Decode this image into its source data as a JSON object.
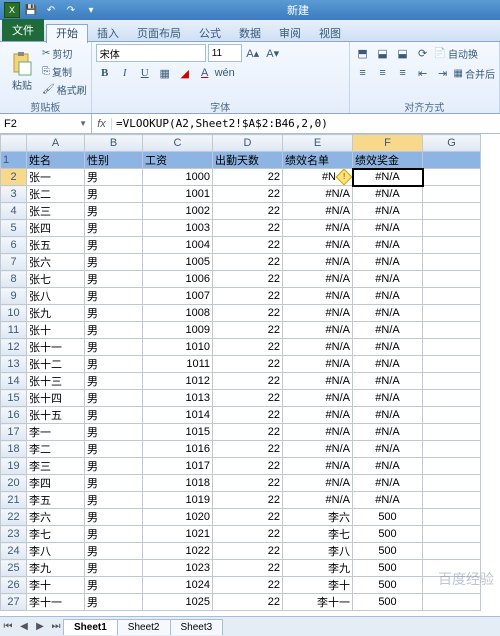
{
  "window": {
    "title": "新建"
  },
  "tabs": {
    "file": "文件",
    "items": [
      "开始",
      "插入",
      "页面布局",
      "公式",
      "数据",
      "审阅",
      "视图"
    ],
    "active": 0
  },
  "ribbon": {
    "clipboard": {
      "paste": "粘贴",
      "cut": "剪切",
      "copy": "复制",
      "format_painter": "格式刷",
      "label": "剪贴板"
    },
    "font": {
      "name": "宋体",
      "size": "11",
      "label": "字体"
    },
    "alignment": {
      "wrap": "自动换",
      "merge": "合并后",
      "label": "对齐方式"
    }
  },
  "formula_bar": {
    "cell_ref": "F2",
    "formula": "=VLOOKUP(A2,Sheet2!$A$2:B46,2,0)"
  },
  "columns": [
    "A",
    "B",
    "C",
    "D",
    "E",
    "F",
    "G"
  ],
  "headers": {
    "A": "姓名",
    "B": "性别",
    "C": "工资",
    "D": "出勤天数",
    "E": "绩效名单",
    "F": "绩效奖金"
  },
  "chart_data": {
    "type": "table",
    "columns": [
      "姓名",
      "性别",
      "工资",
      "出勤天数",
      "绩效名单",
      "绩效奖金"
    ],
    "rows": [
      [
        "张一",
        "男",
        1000,
        22,
        "#N/A",
        "#N/A"
      ],
      [
        "张二",
        "男",
        1001,
        22,
        "#N/A",
        "#N/A"
      ],
      [
        "张三",
        "男",
        1002,
        22,
        "#N/A",
        "#N/A"
      ],
      [
        "张四",
        "男",
        1003,
        22,
        "#N/A",
        "#N/A"
      ],
      [
        "张五",
        "男",
        1004,
        22,
        "#N/A",
        "#N/A"
      ],
      [
        "张六",
        "男",
        1005,
        22,
        "#N/A",
        "#N/A"
      ],
      [
        "张七",
        "男",
        1006,
        22,
        "#N/A",
        "#N/A"
      ],
      [
        "张八",
        "男",
        1007,
        22,
        "#N/A",
        "#N/A"
      ],
      [
        "张九",
        "男",
        1008,
        22,
        "#N/A",
        "#N/A"
      ],
      [
        "张十",
        "男",
        1009,
        22,
        "#N/A",
        "#N/A"
      ],
      [
        "张十一",
        "男",
        1010,
        22,
        "#N/A",
        "#N/A"
      ],
      [
        "张十二",
        "男",
        1011,
        22,
        "#N/A",
        "#N/A"
      ],
      [
        "张十三",
        "男",
        1012,
        22,
        "#N/A",
        "#N/A"
      ],
      [
        "张十四",
        "男",
        1013,
        22,
        "#N/A",
        "#N/A"
      ],
      [
        "张十五",
        "男",
        1014,
        22,
        "#N/A",
        "#N/A"
      ],
      [
        "李一",
        "男",
        1015,
        22,
        "#N/A",
        "#N/A"
      ],
      [
        "李二",
        "男",
        1016,
        22,
        "#N/A",
        "#N/A"
      ],
      [
        "李三",
        "男",
        1017,
        22,
        "#N/A",
        "#N/A"
      ],
      [
        "李四",
        "男",
        1018,
        22,
        "#N/A",
        "#N/A"
      ],
      [
        "李五",
        "男",
        1019,
        22,
        "#N/A",
        "#N/A"
      ],
      [
        "李六",
        "男",
        1020,
        22,
        "李六",
        500
      ],
      [
        "李七",
        "男",
        1021,
        22,
        "李七",
        500
      ],
      [
        "李八",
        "男",
        1022,
        22,
        "李八",
        500
      ],
      [
        "李九",
        "男",
        1023,
        22,
        "李九",
        500
      ],
      [
        "李十",
        "男",
        1024,
        22,
        "李十",
        500
      ],
      [
        "李十一",
        "男",
        1025,
        22,
        "李十一",
        500
      ]
    ]
  },
  "row2_E_display": "#N",
  "sheets": [
    "Sheet1",
    "Sheet2",
    "Sheet3"
  ],
  "active_sheet": 0,
  "watermark": "百度经验"
}
